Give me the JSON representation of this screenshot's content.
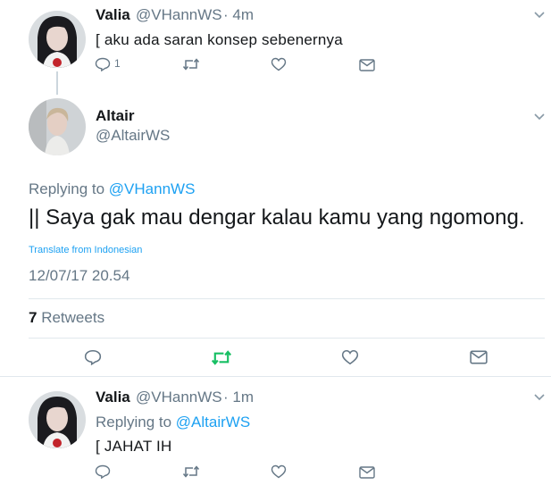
{
  "tweet1": {
    "name": "Valia",
    "handle": "@VHannWS",
    "time": "· 4m",
    "text": "[ aku ada saran konsep sebenernya",
    "reply_count": "1"
  },
  "main": {
    "name": "Altair",
    "handle": "@AltairWS",
    "replying_prefix": "Replying to",
    "replying_handle": "@VHannWS",
    "text": "|| Saya gak mau dengar kalau kamu yang ngomong.",
    "translate": "Translate from Indonesian",
    "timestamp": "12/07/17 20.54",
    "retweet_count": "7",
    "retweet_label": "Retweets"
  },
  "tweet3": {
    "name": "Valia",
    "handle": "@VHannWS",
    "time": "· 1m",
    "replying_prefix": "Replying to",
    "replying_handle": "@AltairWS",
    "text": "[ JAHAT IH"
  },
  "colors": {
    "accent": "#1da1f2",
    "retweet_green": "#17bf63",
    "grey": "#657786",
    "divider": "#e1e8ed"
  },
  "icons": [
    "reply-icon",
    "retweet-icon",
    "like-icon",
    "message-icon",
    "chevron-down-icon"
  ]
}
